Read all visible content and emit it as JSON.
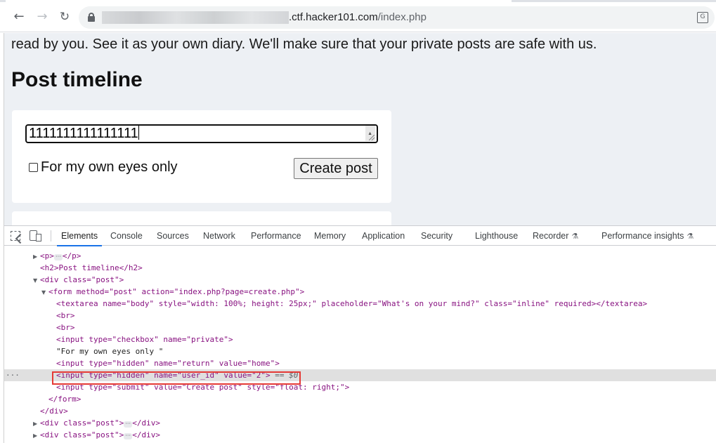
{
  "browser": {
    "url_domain": ".ctf.hacker101.com",
    "url_path": "/index.php"
  },
  "page": {
    "intro_line": "read by you. See it as your own diary. We'll make sure that your private posts are safe with us.",
    "timeline_title": "Post timeline",
    "post_form": {
      "textarea_value": "1111111111111111",
      "checkbox_label": "For my own eyes only",
      "submit_label": "Create post"
    }
  },
  "devtools": {
    "tabs": [
      "Elements",
      "Console",
      "Sources",
      "Network",
      "Performance",
      "Memory",
      "Application",
      "Security",
      "Lighthouse",
      "Recorder",
      "Performance insights"
    ],
    "active_tab": "Elements",
    "dom_lines": {
      "p_open": "<p>",
      "p_close": "</p>",
      "h2": "<h2>Post timeline</h2>",
      "div_post_open": "<div class=\"post\">",
      "form_open": "<form method=\"post\" action=\"index.php?page=create.php\">",
      "textarea": "<textarea name=\"body\" style=\"width: 100%; height: 25px;\" placeholder=\"What's on your mind?\" class=\"inline\" required></textarea>",
      "br": "<br>",
      "input_checkbox": "<input type=\"checkbox\" name=\"private\">",
      "text_node": "\"For my own eyes only \"",
      "input_return": "<input type=\"hidden\" name=\"return\" value=\"home\">",
      "input_user_id": "<input type=\"hidden\" name=\"user_id\" value=\"2\">",
      "selected_marker": "== $0",
      "input_submit": "<input type=\"submit\" value=\"Create post\" style=\"float: right;\">",
      "form_close": "</form>",
      "div_close": "</div>",
      "div_post_collapsed": "<div class=\"post\">",
      "div_close_after": "</div>"
    }
  }
}
